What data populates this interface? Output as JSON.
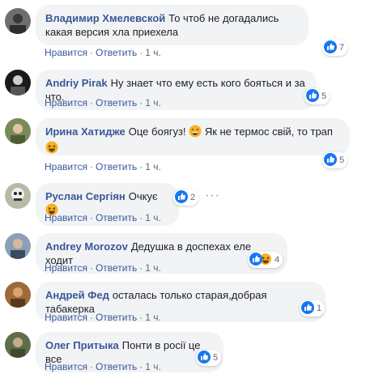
{
  "comments": [
    {
      "author": "Владимир Хмелевской",
      "text": "То чтоб не догадались какая версия хла приехела",
      "like": "Нравится",
      "reply": "Ответить",
      "time": "1 ч.",
      "reactions": "7"
    },
    {
      "author": "Andriy Pirak",
      "text": "Ну знает что ему есть кого бояться и за что.",
      "like": "Нравится",
      "reply": "Ответить",
      "time": "1 ч.",
      "reactions": "5"
    },
    {
      "author": "Ирина Хатидже",
      "text": "Оце боягуз!",
      "text2": "Як не термос свій, то трап",
      "like": "Нравится",
      "reply": "Ответить",
      "time": "1 ч.",
      "reactions": "5"
    },
    {
      "author": "Руслан Сергіян",
      "text": "Очкує",
      "like": "Нравится",
      "reply": "Ответить",
      "time": "1 ч.",
      "reactions": "2"
    },
    {
      "author": "Andrey Morozov",
      "text": "Дедушка в доспехах еле ходит",
      "like": "Нравится",
      "reply": "Ответить",
      "time": "1 ч.",
      "reactions": "4"
    },
    {
      "author": "Андрей Фед",
      "text": "осталась только старая,добрая табакерка",
      "like": "Нравится",
      "reply": "Ответить",
      "time": "1 ч.",
      "reactions": "1"
    },
    {
      "author": "Олег Притыка",
      "text": "Понти в росії це все",
      "like": "Нравится",
      "reply": "Ответить",
      "time": "1 ч.",
      "reactions": "5"
    }
  ],
  "colors": {
    "link": "#385898",
    "bubble": "#f2f3f5",
    "like_blue": "#1877f2",
    "haha_yellow": "#f7b125"
  },
  "icons": [
    "like-icon",
    "haha-icon",
    "grin-emoji",
    "laughing-emoji",
    "more-options-icon"
  ],
  "more_label": "···"
}
